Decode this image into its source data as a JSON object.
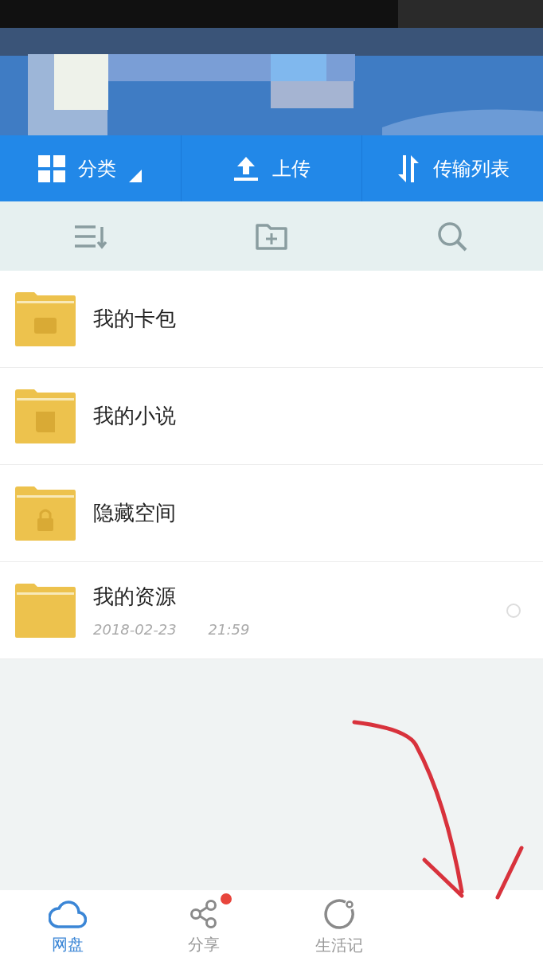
{
  "actions": [
    {
      "kind": "grid",
      "label": "分类",
      "dropdown": true
    },
    {
      "kind": "upload",
      "label": "上传",
      "dropdown": false
    },
    {
      "kind": "transfer",
      "label": "传输列表",
      "dropdown": false
    }
  ],
  "toolbar": [
    {
      "kind": "sort"
    },
    {
      "kind": "new-folder"
    },
    {
      "kind": "search"
    }
  ],
  "files": [
    {
      "name": "我的卡包",
      "kind": "wallet"
    },
    {
      "name": "我的小说",
      "kind": "book"
    },
    {
      "name": "隐藏空间",
      "kind": "lock"
    },
    {
      "name": "我的资源",
      "kind": "plain",
      "date": "2018-02-23",
      "time": "21:59",
      "selected": false
    }
  ],
  "nav": [
    {
      "label": "网盘",
      "kind": "cloud",
      "selected": true,
      "badge": false
    },
    {
      "label": "分享",
      "kind": "share",
      "selected": false,
      "badge": true
    },
    {
      "label": "生活记",
      "kind": "circle",
      "selected": false,
      "badge": false
    }
  ]
}
